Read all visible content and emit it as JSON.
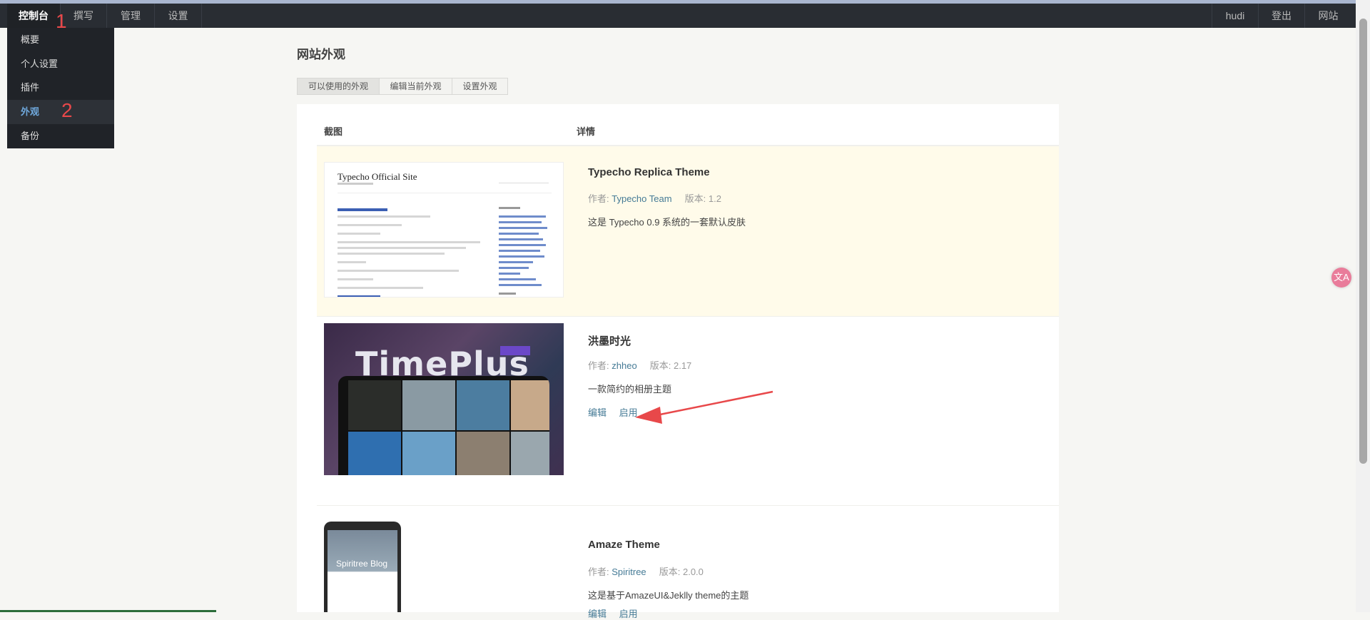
{
  "topnav": {
    "left": [
      {
        "label": "控制台",
        "active": true
      },
      {
        "label": "撰写"
      },
      {
        "label": "管理"
      },
      {
        "label": "设置"
      }
    ],
    "right": [
      {
        "label": "hudi"
      },
      {
        "label": "登出"
      },
      {
        "label": "网站"
      }
    ]
  },
  "dropdown": {
    "items": [
      {
        "label": "概要"
      },
      {
        "label": "个人设置"
      },
      {
        "label": "插件"
      },
      {
        "label": "外观",
        "active": true
      },
      {
        "label": "备份"
      }
    ]
  },
  "annotations": {
    "one": "1",
    "two": "2"
  },
  "page": {
    "title": "网站外观",
    "tabs": [
      {
        "label": "可以使用的外观",
        "active": true
      },
      {
        "label": "编辑当前外观"
      },
      {
        "label": "设置外观"
      }
    ],
    "table": {
      "col_screenshot": "截图",
      "col_details": "详情"
    },
    "themes": [
      {
        "name": "Typecho Replica Theme",
        "author_label": "作者:",
        "author": "Typecho Team",
        "version_label": "版本:",
        "version": "1.2",
        "description": "这是 Typecho 0.9 系统的一套默认皮肤",
        "active": true,
        "shot_title": "Typecho Official Site"
      },
      {
        "name": "洪墨时光",
        "author_label": "作者:",
        "author": "zhheo",
        "version_label": "版本:",
        "version": "2.17",
        "description": "一款简约的相册主题",
        "edit": "编辑",
        "enable": "启用",
        "shot_title": "TimePlus"
      },
      {
        "name": "Amaze Theme",
        "author_label": "作者:",
        "author": "Spiritree",
        "version_label": "版本:",
        "version": "2.0.0",
        "description": "这是基于AmazeUI&Jeklly theme的主题",
        "edit": "编辑",
        "enable": "启用",
        "shot_title": "Spiritree Blog"
      }
    ]
  },
  "float_button": {
    "glyph": "文A",
    "icon": "translate-icon"
  },
  "colors": {
    "accent_link": "#467b96",
    "active_row": "#fffbea",
    "annotation_red": "#e8484a"
  }
}
